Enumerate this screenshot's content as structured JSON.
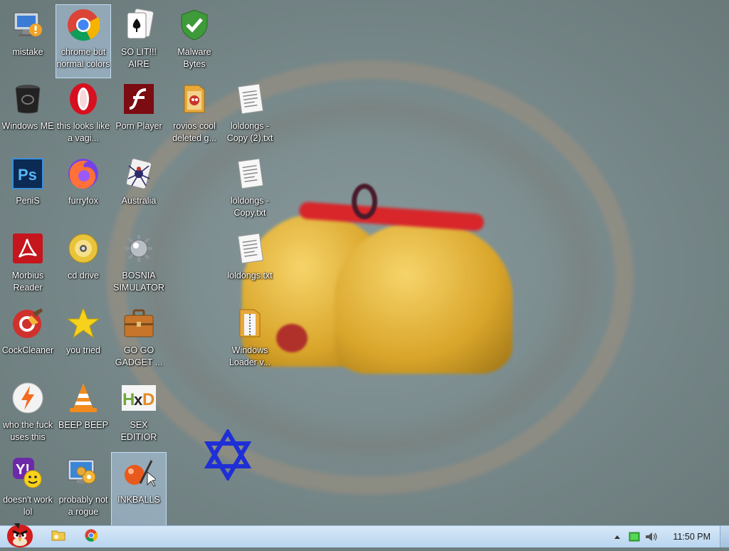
{
  "desktop": {
    "icons": [
      {
        "label": "mistake",
        "icon": "computer-update-icon"
      },
      {
        "label": "chrome but normal colors",
        "icon": "chrome-icon"
      },
      {
        "label": "SO LIT!!! AIRE",
        "icon": "solitaire-icon"
      },
      {
        "label": "Malware Bytes",
        "icon": "shield-check-icon"
      },
      {
        "label": "Windows ME",
        "icon": "recycle-bin-icon"
      },
      {
        "label": "this looks like a vagi...",
        "icon": "opera-icon"
      },
      {
        "label": "Porn Player",
        "icon": "flash-player-icon"
      },
      {
        "label": "rovios cool deleted g...",
        "icon": "folder-icon"
      },
      {
        "label": "loldongs - Copy (2).txt",
        "icon": "text-file-icon"
      },
      {
        "label": "PeniS",
        "icon": "photoshop-icon"
      },
      {
        "label": "furryfox",
        "icon": "firefox-icon"
      },
      {
        "label": "Australia",
        "icon": "spider-solitaire-icon"
      },
      {
        "label": "loldongs - Copy.txt",
        "icon": "text-file-icon"
      },
      {
        "label": "Morbius Reader",
        "icon": "acrobat-icon"
      },
      {
        "label": "cd drive",
        "icon": "cd-drive-icon"
      },
      {
        "label": "BOSNIA SIMULATOR",
        "icon": "minesweeper-icon"
      },
      {
        "label": "loldongs.txt",
        "icon": "text-file-icon"
      },
      {
        "label": "CockCleaner",
        "icon": "ccleaner-icon"
      },
      {
        "label": "you tried",
        "icon": "star-icon"
      },
      {
        "label": "GO GO GADGET ...",
        "icon": "briefcase-icon"
      },
      {
        "label": "Windows Loader v...",
        "icon": "folder-zip-icon"
      },
      {
        "label": "who the fuck uses this",
        "icon": "avast-icon"
      },
      {
        "label": "BEEP BEEP",
        "icon": "vlc-cone-icon"
      },
      {
        "label": "SEX EDITIOR",
        "icon": "hxd-icon"
      },
      {
        "label": "doesn't work lol",
        "icon": "yahoo-messenger-icon"
      },
      {
        "label": "probably not a rogue",
        "icon": "settings-monitor-icon"
      },
      {
        "label": "INKBALLS",
        "icon": "inkball-icon"
      }
    ]
  },
  "taskbar": {
    "start_icon": "angry-bird-start-icon",
    "pinned": [
      {
        "icon": "explorer-folder-icon"
      },
      {
        "icon": "chrome-icon"
      }
    ],
    "tray_icons": [
      "show-hidden-icons-arrow",
      "battery-icon",
      "volume-icon"
    ],
    "clock": "11:50 PM"
  },
  "colors": {
    "taskbar_top": "#d6e8f8",
    "selection": "#bedcfa",
    "star_blue": "#1f2fd6"
  }
}
